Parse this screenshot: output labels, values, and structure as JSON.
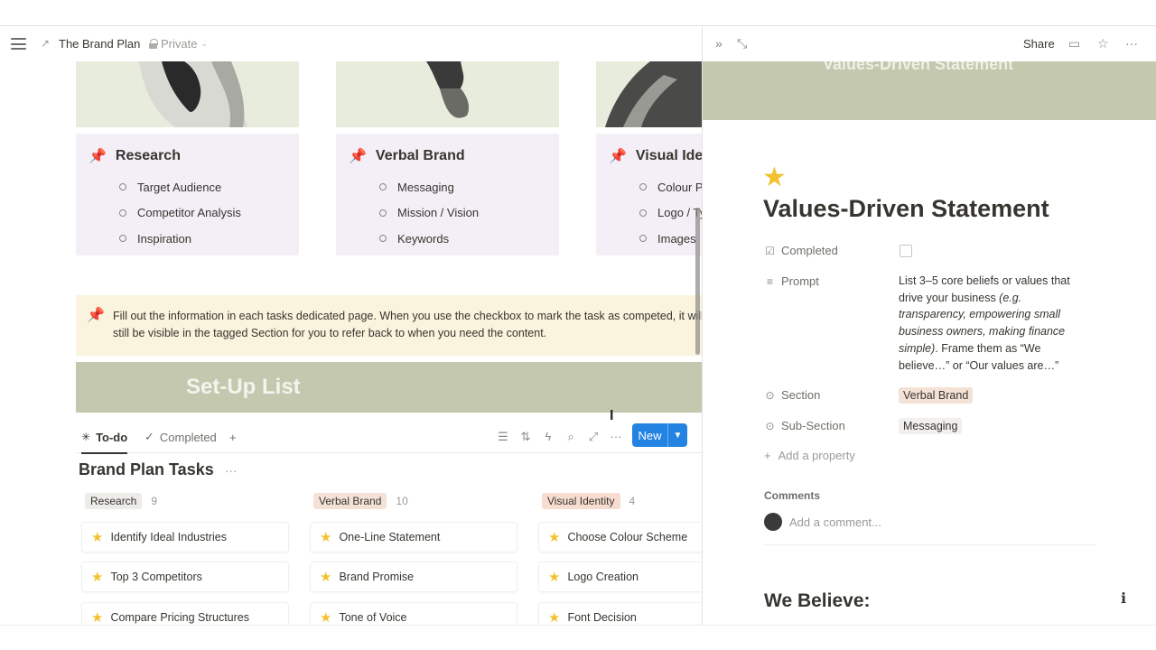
{
  "breadcrumb": {
    "icon": "↗",
    "title": "The Brand Plan",
    "privacy": "Private"
  },
  "gallery": [
    {
      "title": "Research",
      "items": [
        "Target Audience",
        "Competitor Analysis",
        "Inspiration"
      ]
    },
    {
      "title": "Verbal Brand",
      "items": [
        "Messaging",
        "Mission / Vision",
        "Keywords"
      ]
    },
    {
      "title": "Visual Identity",
      "items": [
        "Colour Palette",
        "Logo / Typography",
        "Images"
      ]
    }
  ],
  "callout": {
    "text": "Fill out the information in each tasks dedicated page. When you use the checkbox to mark the task as competed, it will still be visible in the tagged Section for you to refer back to when you need the content."
  },
  "banner": {
    "text": "Set-Up List"
  },
  "views": {
    "tabs": [
      "To-do",
      "Completed"
    ],
    "add": "+",
    "new_label": "New"
  },
  "board": {
    "title": "Brand Plan Tasks",
    "columns": [
      {
        "tag": "Research",
        "count": "9",
        "color": "#eeece9",
        "tasks": [
          "Identify Ideal Industries",
          "Top 3 Competitors",
          "Compare Pricing Structures"
        ]
      },
      {
        "tag": "Verbal Brand",
        "count": "10",
        "color": "#f4e2d6",
        "tasks": [
          "One-Line Statement",
          "Brand Promise",
          "Tone of Voice"
        ]
      },
      {
        "tag": "Visual Identity",
        "count": "4",
        "color": "#f7dcd0",
        "tasks": [
          "Choose Colour Scheme",
          "Logo Creation",
          "Font Decision"
        ]
      }
    ]
  },
  "peek": {
    "share": "Share",
    "cover_text": "Values-Driven Statement",
    "title": "Values-Driven Statement",
    "props": {
      "completed_label": "Completed",
      "prompt_label": "Prompt",
      "prompt_pre": "List 3–5 core beliefs or values that drive your business ",
      "prompt_em": "(e.g. transparency, empowering small business owners, making finance simple)",
      "prompt_post": ". Frame them as “We believe…” or “Our values are…”",
      "section_label": "Section",
      "section_value": "Verbal Brand",
      "subsection_label": "Sub-Section",
      "subsection_value": "Messaging",
      "add_property": "Add a property"
    },
    "comments_label": "Comments",
    "comment_placeholder": "Add a comment...",
    "heading": "We Believe:"
  }
}
